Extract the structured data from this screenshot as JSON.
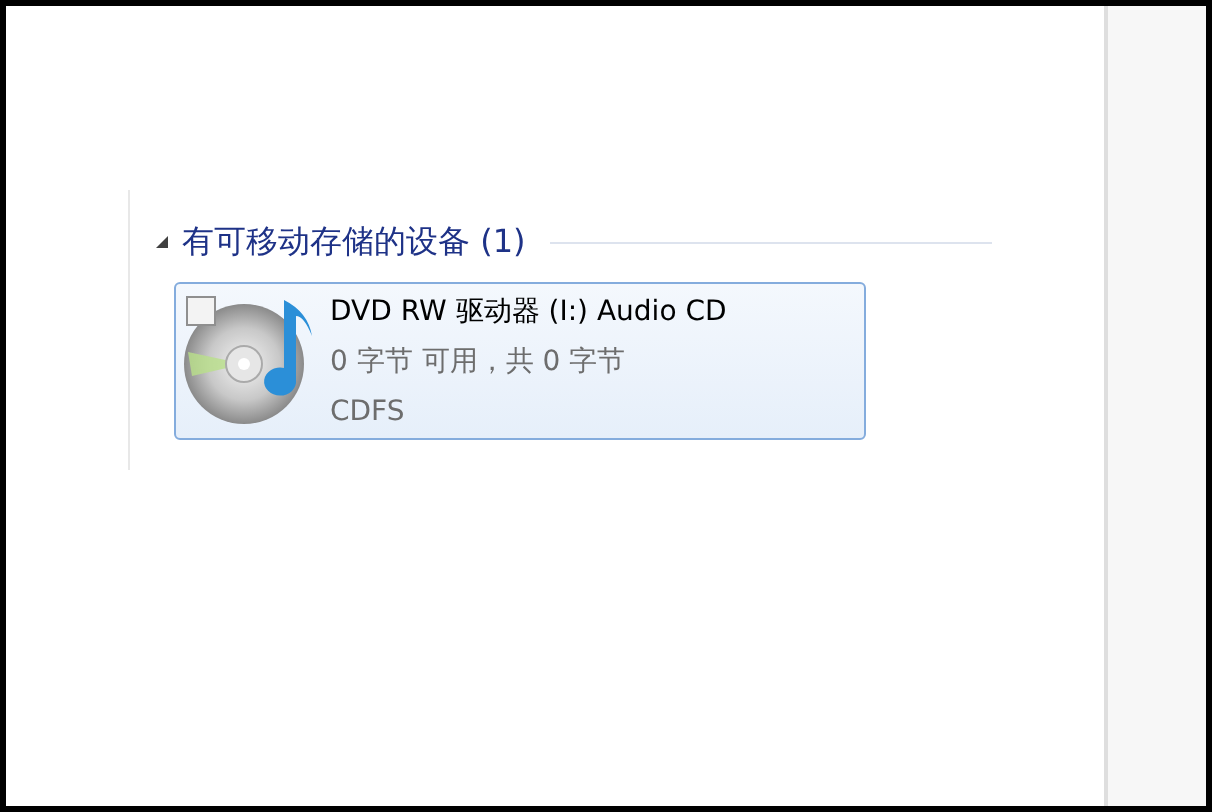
{
  "section": {
    "title": "有可移动存储的设备 (1)",
    "expanded": true,
    "devices": [
      {
        "name": "DVD RW 驱动器 (I:) Audio CD",
        "space": "0 字节 可用，共 0 字节",
        "filesystem": "CDFS",
        "selected": true,
        "checked": false
      }
    ]
  }
}
